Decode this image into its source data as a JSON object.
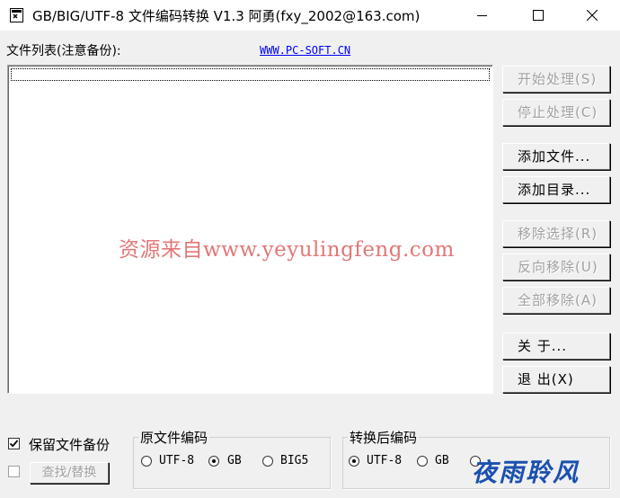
{
  "window": {
    "title": "GB/BIG/UTF-8 文件编码转换 V1.3  阿勇(fxy_2002@163.com)",
    "icon": "app-icon",
    "controls": [
      "minimize-icon",
      "maximize-icon",
      "close-icon"
    ]
  },
  "filelist": {
    "label": "文件列表(注意备份):",
    "link": "WWW.PC-SOFT.CN"
  },
  "watermark": "资源来自www.yeyulingfeng.com",
  "buttons": {
    "start": "开始处理(S)",
    "stop": "停止处理(C)",
    "add_file": "添加文件...",
    "add_dir": "添加目录...",
    "remove_sel": "移除选择(R)",
    "reverse_remove": "反向移除(U)",
    "remove_all": "全部移除(A)",
    "about": "关    于...",
    "exit": "退    出(X)"
  },
  "options": {
    "keep_backup": {
      "label": "保留文件备份",
      "checked": true
    },
    "find_replace": {
      "label": "查找/替换",
      "checked": false,
      "button": "查找/替换"
    }
  },
  "source_encoding": {
    "title": "原文件编码",
    "options": [
      "UTF-8",
      "GB",
      "BIG5"
    ],
    "selected": "GB"
  },
  "target_encoding": {
    "title": "转换后编码",
    "options": [
      "UTF-8",
      "GB"
    ],
    "selected": "UTF-8"
  },
  "corner_logo": "夜雨聆风"
}
